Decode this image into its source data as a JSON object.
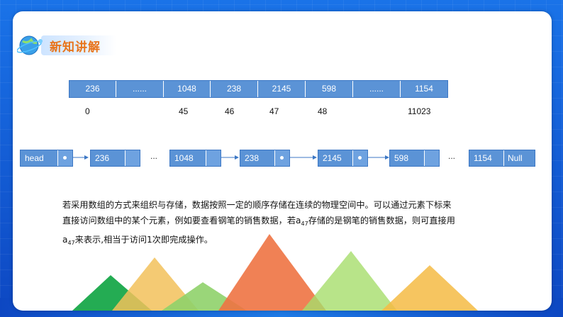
{
  "header": {
    "title": "新知讲解",
    "icon": "globe-icon"
  },
  "array": {
    "cells": [
      "236",
      "......",
      "1048",
      "238",
      "2145",
      "598",
      "......",
      "1154"
    ],
    "indices": [
      "0",
      "45",
      "46",
      "47",
      "48",
      "11023"
    ]
  },
  "linked_list": {
    "nodes": [
      "head",
      "236",
      "1048",
      "238",
      "2145",
      "598",
      "1154"
    ],
    "ellipsis": "...",
    "null_label": "Null"
  },
  "paragraph": {
    "line1": "若采用数组的方式来组织与存储，数据按照一定的顺序存储在连续的物理空间中。可以通过元素下标来",
    "line2_a": "直接访问数组中的某个元素，例如要查看钢笔的销售数据，若a",
    "sub": "47",
    "line2_b": "存储的是钢笔的销售数据，则可直接用",
    "line3_a": "a",
    "line3_b": "来表示,相当于访问1次即完成操作。"
  },
  "colors": {
    "cell_fill": "#5b93d6",
    "title_color": "#e8741a",
    "background": "#1565d8"
  }
}
